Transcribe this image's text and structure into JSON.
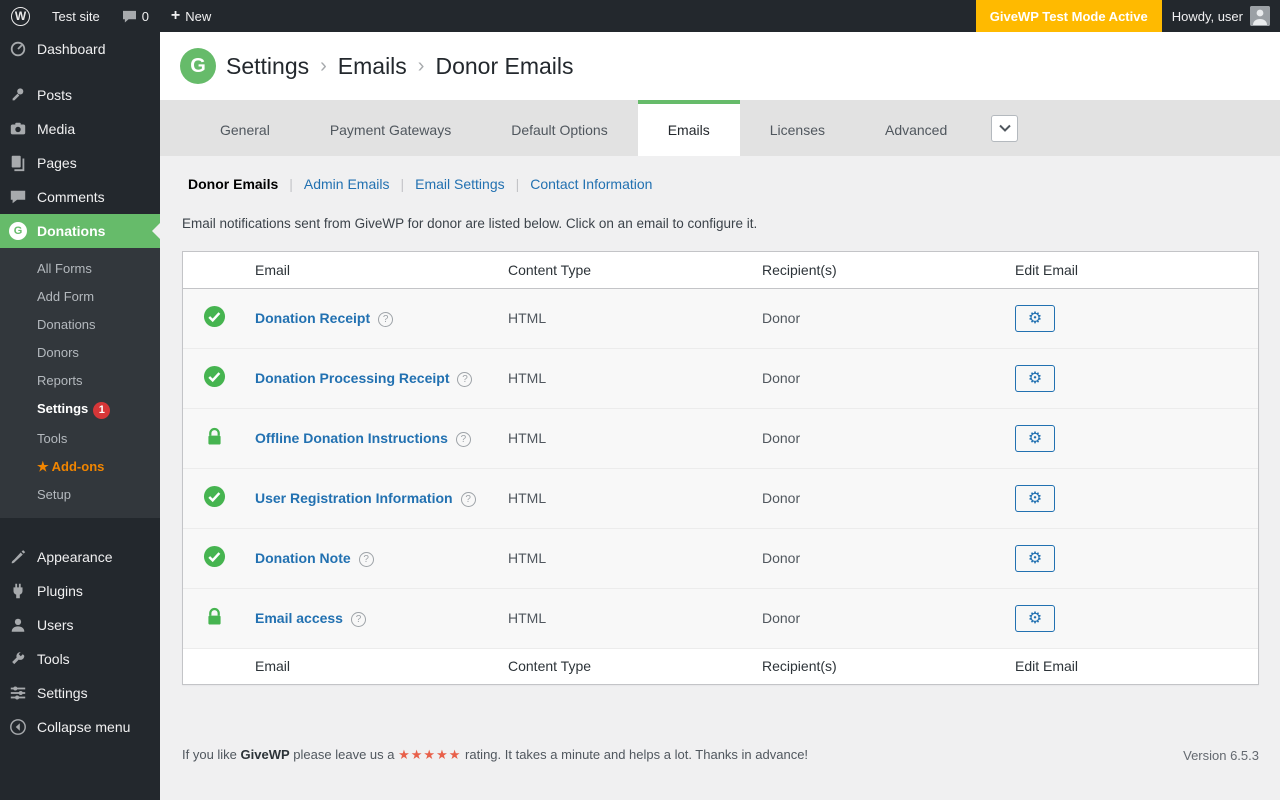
{
  "admin_bar": {
    "site_name": "Test site",
    "comments_count": "0",
    "new_label": "New",
    "test_mode_badge": "GiveWP Test Mode Active",
    "howdy_text": "Howdy, user"
  },
  "sidebar": {
    "top_items": [
      {
        "label": "Dashboard"
      },
      {
        "label": "Posts"
      },
      {
        "label": "Media"
      },
      {
        "label": "Pages"
      },
      {
        "label": "Comments"
      }
    ],
    "donations_label": "Donations",
    "submenu": [
      {
        "label": "All Forms"
      },
      {
        "label": "Add Form"
      },
      {
        "label": "Donations"
      },
      {
        "label": "Donors"
      },
      {
        "label": "Reports"
      },
      {
        "label": "Settings",
        "badge": "1"
      },
      {
        "label": "Tools"
      },
      {
        "label": "Add-ons"
      },
      {
        "label": "Setup"
      }
    ],
    "bottom_items": [
      {
        "label": "Appearance"
      },
      {
        "label": "Plugins"
      },
      {
        "label": "Users"
      },
      {
        "label": "Tools"
      },
      {
        "label": "Settings"
      }
    ],
    "collapse_label": "Collapse menu"
  },
  "header": {
    "breadcrumb": [
      "Settings",
      "Emails",
      "Donor Emails"
    ],
    "separator": "›"
  },
  "tabs": [
    {
      "label": "General"
    },
    {
      "label": "Payment Gateways"
    },
    {
      "label": "Default Options"
    },
    {
      "label": "Emails",
      "active": true
    },
    {
      "label": "Licenses"
    },
    {
      "label": "Advanced"
    }
  ],
  "subnav": {
    "separator": "|",
    "items": [
      {
        "label": "Donor Emails",
        "current": true
      },
      {
        "label": "Admin Emails"
      },
      {
        "label": "Email Settings"
      },
      {
        "label": "Contact Information"
      }
    ]
  },
  "description": "Email notifications sent from GiveWP for donor are listed below. Click on an email to configure it.",
  "table": {
    "columns": {
      "email": "Email",
      "content_type": "Content Type",
      "recipients": "Recipient(s)",
      "edit": "Edit Email"
    },
    "rows": [
      {
        "name": "Donation Receipt",
        "status": "enabled",
        "content_type": "HTML",
        "recipient": "Donor"
      },
      {
        "name": "Donation Processing Receipt",
        "status": "enabled",
        "content_type": "HTML",
        "recipient": "Donor"
      },
      {
        "name": "Offline Donation Instructions",
        "status": "locked",
        "content_type": "HTML",
        "recipient": "Donor"
      },
      {
        "name": "User Registration Information",
        "status": "enabled",
        "content_type": "HTML",
        "recipient": "Donor"
      },
      {
        "name": "Donation Note",
        "status": "enabled",
        "content_type": "HTML",
        "recipient": "Donor"
      },
      {
        "name": "Email access",
        "status": "locked",
        "content_type": "HTML",
        "recipient": "Donor"
      }
    ]
  },
  "footer": {
    "rating_prefix": "If you like",
    "brand": "GiveWP",
    "rating_mid": "please leave us a",
    "stars": "★★★★★",
    "rating_suffix": "rating. It takes a minute and helps a lot. Thanks in advance!",
    "version": "Version 6.5.3"
  },
  "icons": {
    "wp": "W",
    "plus": "+",
    "help": "?",
    "gear": "⚙",
    "star": "★",
    "give_logo": "G"
  },
  "colors": {
    "givewp_green": "#66bb6a",
    "link_blue": "#2271b1",
    "status_green": "#46b450",
    "badge_red": "#d63638",
    "test_badge_bg": "#ffba00",
    "star_color": "#e8604a",
    "addons_orange": "#f18500"
  }
}
